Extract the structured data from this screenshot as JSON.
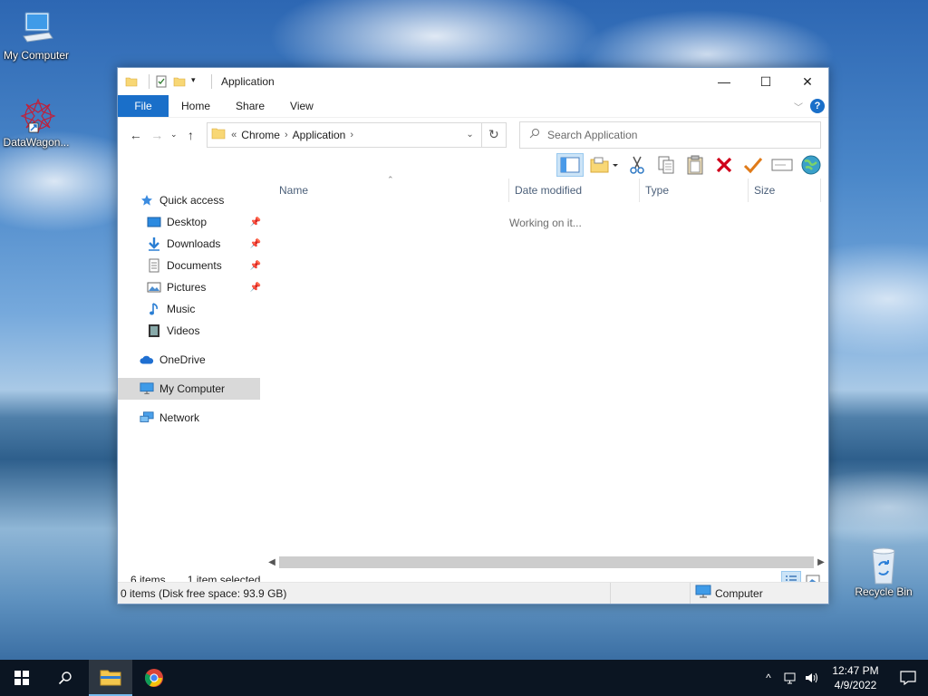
{
  "desktop": {
    "icons": [
      {
        "label": "My Computer",
        "icon": "computer-icon"
      },
      {
        "label": "DataWagon...",
        "icon": "datawagon-icon"
      },
      {
        "label": "Recycle Bin",
        "icon": "recycle-bin-icon"
      }
    ]
  },
  "window": {
    "title": "Application",
    "controls": {
      "minimize": "—",
      "maximize": "☐",
      "close": "✕"
    },
    "ribbon": {
      "tabs": [
        "File",
        "Home",
        "Share",
        "View"
      ],
      "help": "?"
    },
    "address": {
      "prefix": "«",
      "crumbs": [
        "Chrome",
        "Application"
      ],
      "sep": "›"
    },
    "search": {
      "placeholder": "Search Application"
    },
    "navpane": {
      "quick_access": "Quick access",
      "items": [
        {
          "label": "Desktop",
          "icon": "desktop-icon",
          "pinned": true
        },
        {
          "label": "Downloads",
          "icon": "downloads-icon",
          "pinned": true
        },
        {
          "label": "Documents",
          "icon": "documents-icon",
          "pinned": true
        },
        {
          "label": "Pictures",
          "icon": "pictures-icon",
          "pinned": true
        },
        {
          "label": "Music",
          "icon": "music-icon",
          "pinned": false
        },
        {
          "label": "Videos",
          "icon": "videos-icon",
          "pinned": false
        }
      ],
      "onedrive": "OneDrive",
      "my_computer": "My Computer",
      "network": "Network"
    },
    "columns": [
      "Name",
      "Date modified",
      "Type",
      "Size"
    ],
    "working_text": "Working on it...",
    "status": {
      "items": "6 items",
      "selected": "1 item selected"
    },
    "bottom": {
      "free": "0 items (Disk free space: 93.9 GB)",
      "location": "Computer"
    }
  },
  "taskbar": {
    "time": "12:47 PM",
    "date": "4/9/2022"
  },
  "colors": {
    "accent": "#1a6fc9",
    "taskbar": "#0b1522",
    "delete_red": "#d0021b",
    "check_orange": "#e07b1a"
  }
}
